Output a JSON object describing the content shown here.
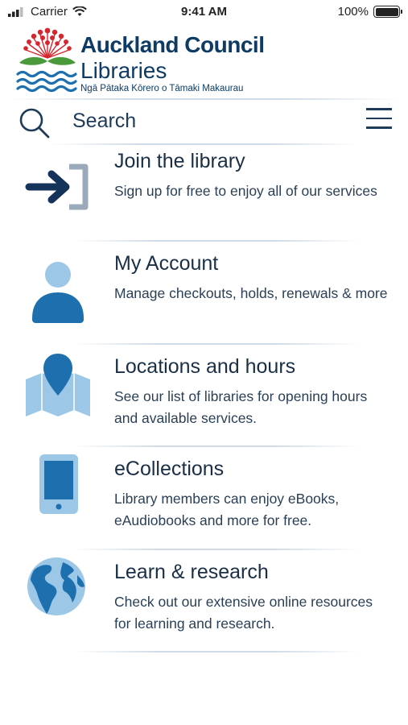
{
  "status_bar": {
    "carrier": "Carrier",
    "time": "9:41 AM",
    "battery": "100%"
  },
  "header": {
    "title": "Auckland Council",
    "subtitle": "Libraries",
    "tagline": "Ngā Pātaka Kōrero o Tāmaki Makaurau"
  },
  "search": {
    "label": "Search"
  },
  "menu": {
    "items": [
      {
        "title": "Join the library",
        "description": "Sign up for free to enjoy all of our services",
        "icon": "join-icon"
      },
      {
        "title": "My Account",
        "description": "Manage checkouts, holds, renewals & more",
        "icon": "account-icon"
      },
      {
        "title": "Locations and hours",
        "description": "See our list of libraries for opening hours and available services.",
        "icon": "map-pin-icon"
      },
      {
        "title": "eCollections",
        "description": "Library members can enjoy eBooks, eAudiobooks and more for free.",
        "icon": "tablet-icon"
      },
      {
        "title": "Learn & research",
        "description": "Check out our extensive online resources for learning and research.",
        "icon": "globe-icon"
      }
    ]
  },
  "colors": {
    "navy": "#0d3b66",
    "icon_blue": "#1d6fae",
    "light_blue": "#9cc7e6",
    "logo_red": "#d7262e",
    "logo_green": "#4a9a3c"
  }
}
